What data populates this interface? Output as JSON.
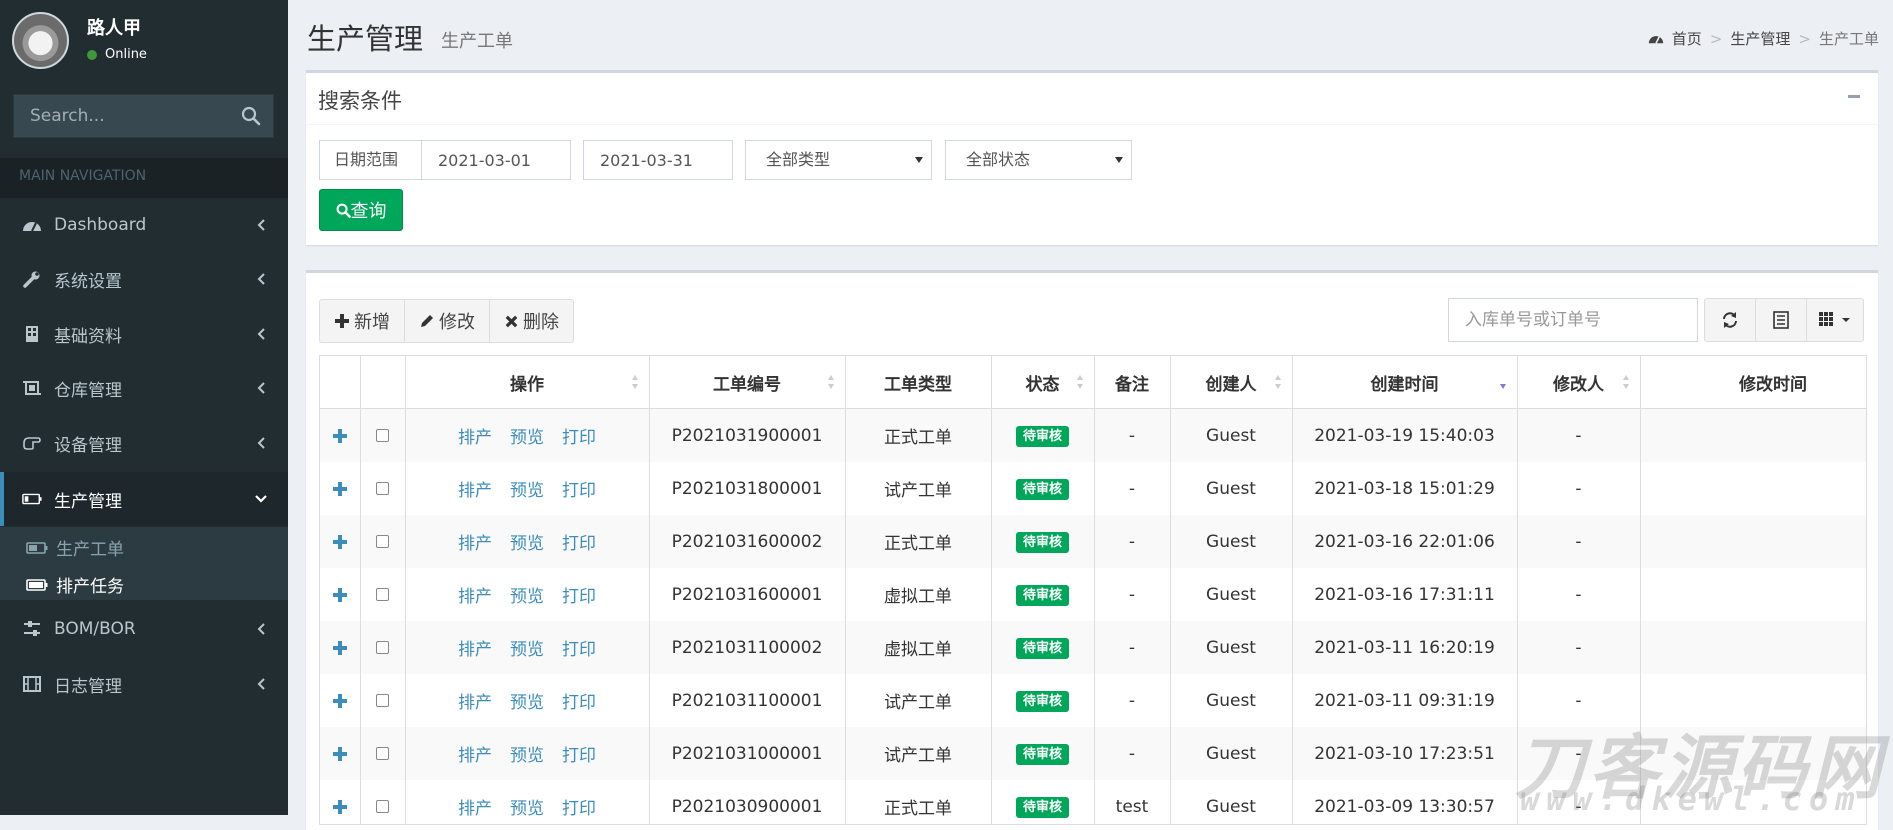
{
  "user": {
    "name": "路人甲",
    "status": "Online"
  },
  "sidebar": {
    "search_placeholder": "Search...",
    "header": "MAIN NAVIGATION",
    "items": [
      {
        "label": "Dashboard"
      },
      {
        "label": "系统设置"
      },
      {
        "label": "基础资料"
      },
      {
        "label": "仓库管理"
      },
      {
        "label": "设备管理"
      },
      {
        "label": "生产管理"
      },
      {
        "label": "BOM/BOR"
      },
      {
        "label": "日志管理"
      }
    ],
    "submenu": [
      {
        "label": "生产工单"
      },
      {
        "label": "排产任务"
      }
    ]
  },
  "header": {
    "title": "生产管理",
    "subtitle": "生产工单",
    "breadcrumb": [
      "首页",
      "生产管理",
      "生产工单"
    ]
  },
  "search_box": {
    "title": "搜索条件",
    "date_range_label": "日期范围",
    "date_from": "2021-03-01",
    "date_to": "2021-03-31",
    "type_select": "全部类型",
    "status_select": "全部状态",
    "query_label": "查询"
  },
  "toolbar": {
    "add_label": "新增",
    "edit_label": "修改",
    "delete_label": "删除",
    "search_placeholder": "入库单号或订单号"
  },
  "table": {
    "columns": [
      "操作",
      "工单编号",
      "工单类型",
      "状态",
      "备注",
      "创建人",
      "创建时间",
      "修改人",
      "修改时间"
    ],
    "actions": [
      "排产",
      "预览",
      "打印"
    ],
    "rows": [
      {
        "no": "P2021031900001",
        "type": "正式工单",
        "status": "待审核",
        "note": "-",
        "creator": "Guest",
        "created": "2021-03-19 15:40:03",
        "modifier": "-",
        "modified": ""
      },
      {
        "no": "P2021031800001",
        "type": "试产工单",
        "status": "待审核",
        "note": "-",
        "creator": "Guest",
        "created": "2021-03-18 15:01:29",
        "modifier": "-",
        "modified": ""
      },
      {
        "no": "P2021031600002",
        "type": "正式工单",
        "status": "待审核",
        "note": "-",
        "creator": "Guest",
        "created": "2021-03-16 22:01:06",
        "modifier": "-",
        "modified": ""
      },
      {
        "no": "P2021031600001",
        "type": "虚拟工单",
        "status": "待审核",
        "note": "-",
        "creator": "Guest",
        "created": "2021-03-16 17:31:11",
        "modifier": "-",
        "modified": ""
      },
      {
        "no": "P2021031100002",
        "type": "虚拟工单",
        "status": "待审核",
        "note": "-",
        "creator": "Guest",
        "created": "2021-03-11 16:20:19",
        "modifier": "-",
        "modified": ""
      },
      {
        "no": "P2021031100001",
        "type": "试产工单",
        "status": "待审核",
        "note": "-",
        "creator": "Guest",
        "created": "2021-03-11 09:31:19",
        "modifier": "-",
        "modified": ""
      },
      {
        "no": "P2021031000001",
        "type": "试产工单",
        "status": "待审核",
        "note": "-",
        "creator": "Guest",
        "created": "2021-03-10 17:23:51",
        "modifier": "-",
        "modified": ""
      },
      {
        "no": "P2021030900001",
        "type": "正式工单",
        "status": "待审核",
        "note": "test",
        "creator": "Guest",
        "created": "2021-03-09 13:30:57",
        "modifier": "-",
        "modified": ""
      }
    ]
  },
  "watermark": {
    "text": "刀客源码网",
    "url": "www.dkewl.com"
  },
  "colors": {
    "sidebar": "#222d32",
    "accent": "#3c8dbc",
    "success": "#00a65a"
  },
  "icons": [
    "search-icon",
    "dashboard-icon",
    "wrench-icon",
    "building-icon",
    "crop-icon",
    "hand-icon",
    "battery-icon",
    "sliders-icon",
    "film-icon",
    "refresh-icon",
    "list-icon",
    "grid-icon"
  ]
}
